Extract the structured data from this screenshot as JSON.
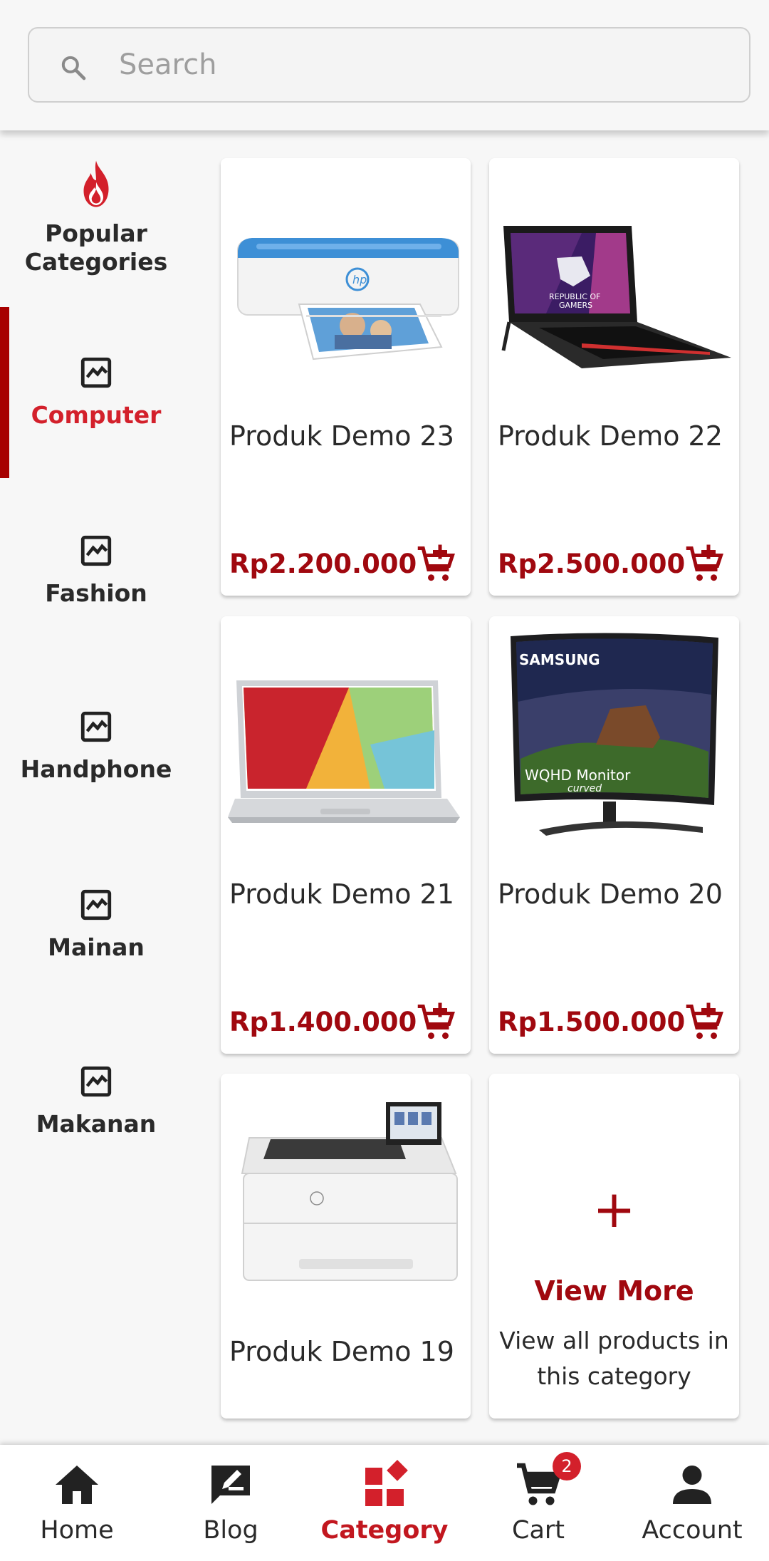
{
  "search": {
    "placeholder": "Search"
  },
  "sidebar": {
    "items": [
      {
        "label": "Popular Categories",
        "icon": "fire-icon",
        "active": false
      },
      {
        "label": "Computer",
        "icon": "image-icon",
        "active": true
      },
      {
        "label": "Fashion",
        "icon": "image-icon",
        "active": false
      },
      {
        "label": "Handphone",
        "icon": "image-icon",
        "active": false
      },
      {
        "label": "Mainan",
        "icon": "image-icon",
        "active": false
      },
      {
        "label": "Makanan",
        "icon": "image-icon",
        "active": false
      }
    ]
  },
  "products": [
    {
      "name": "Produk Demo 23",
      "price": "Rp2.200.000",
      "image": "inkjet-printer"
    },
    {
      "name": "Produk Demo 22",
      "price": "Rp2.500.000",
      "image": "gaming-laptop"
    },
    {
      "name": "Produk Demo 21",
      "price": "Rp1.400.000",
      "image": "laptop"
    },
    {
      "name": "Produk Demo 20",
      "price": "Rp1.500.000",
      "image": "monitor"
    },
    {
      "name": "Produk Demo 19",
      "price": "",
      "image": "laser-printer"
    }
  ],
  "view_more": {
    "title": "View More",
    "description": "View all products in this category"
  },
  "bottom_nav": {
    "items": [
      {
        "label": "Home",
        "icon": "home-icon"
      },
      {
        "label": "Blog",
        "icon": "blog-icon"
      },
      {
        "label": "Category",
        "icon": "category-icon",
        "active": true
      },
      {
        "label": "Cart",
        "icon": "cart-icon",
        "badge": "2"
      },
      {
        "label": "Account",
        "icon": "account-icon"
      }
    ]
  },
  "colors": {
    "accent": "#a0080f",
    "active_category": "#d3202b",
    "active_bar": "#a70000",
    "badge": "#d3202b"
  }
}
